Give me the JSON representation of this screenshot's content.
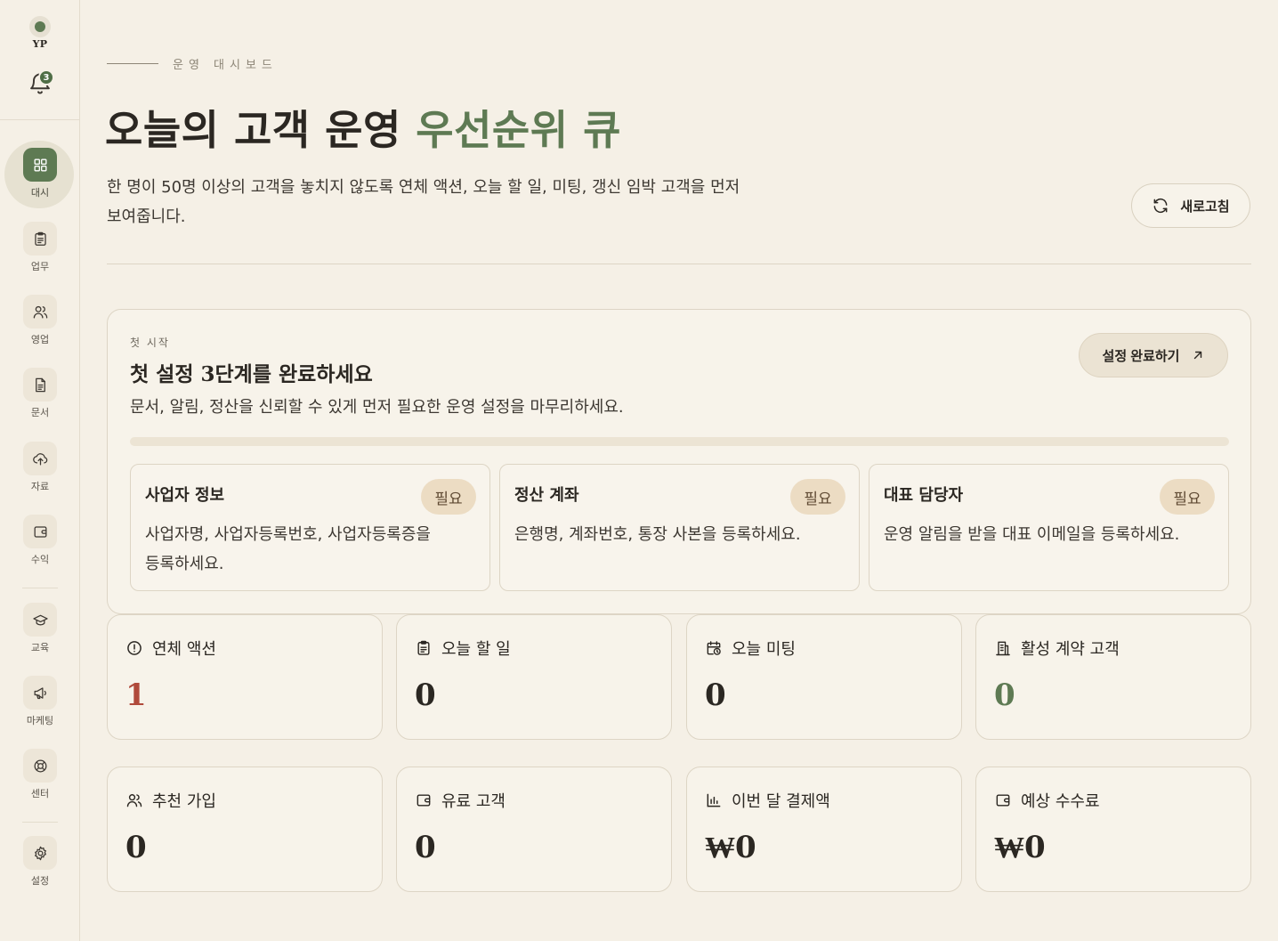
{
  "sidebar": {
    "profile_initials": "YP",
    "notifications_count": "3",
    "items": [
      {
        "label": "대시",
        "icon": "grid-icon",
        "active": true
      },
      {
        "label": "업무",
        "icon": "clipboard-icon"
      },
      {
        "label": "영업",
        "icon": "users-icon"
      },
      {
        "label": "문서",
        "icon": "document-icon"
      },
      {
        "label": "자료",
        "icon": "cloud-upload-icon"
      },
      {
        "label": "수익",
        "icon": "wallet-icon"
      },
      {
        "label": "교육",
        "icon": "graduation-cap-icon"
      },
      {
        "label": "마케팅",
        "icon": "megaphone-icon"
      },
      {
        "label": "센터",
        "icon": "lifebuoy-icon"
      },
      {
        "label": "설정",
        "icon": "gear-icon"
      }
    ]
  },
  "header": {
    "eyebrow": "운영 대시보드",
    "title_main": "오늘의 고객 운영 ",
    "title_accent": "우선순위 큐",
    "description": "한 명이 50명 이상의 고객을 놓치지 않도록 연체 액션, 오늘 할 일, 미팅, 갱신 임박 고객을 먼저 보여줍니다.",
    "refresh_label": "새로고침"
  },
  "setup": {
    "eyebrow": "첫 시작",
    "title": "첫 설정 3단계를 완료하세요",
    "description": "문서, 알림, 정산을 신뢰할 수 있게 먼저 필요한 운영 설정을 마무리하세요.",
    "button_label": "설정 완료하기",
    "progress_percent": 0,
    "steps": [
      {
        "title": "사업자 정보",
        "badge": "필요",
        "description": "사업자명, 사업자등록번호, 사업자등록증을 등록하세요."
      },
      {
        "title": "정산 계좌",
        "badge": "필요",
        "description": "은행명, 계좌번호, 통장 사본을 등록하세요."
      },
      {
        "title": "대표 담당자",
        "badge": "필요",
        "description": "운영 알림을 받을 대표 이메일을 등록하세요."
      }
    ]
  },
  "stats": [
    {
      "label": "연체 액션",
      "value": "1",
      "icon": "alert-circle-icon",
      "tone": "red"
    },
    {
      "label": "오늘 할 일",
      "value": "0",
      "icon": "clipboard-icon",
      "tone": "default"
    },
    {
      "label": "오늘 미팅",
      "value": "0",
      "icon": "calendar-clock-icon",
      "tone": "default"
    },
    {
      "label": "활성 계약 고객",
      "value": "0",
      "icon": "building-icon",
      "tone": "green"
    },
    {
      "label": "추천 가입",
      "value": "0",
      "icon": "users-icon",
      "tone": "default"
    },
    {
      "label": "유료 고객",
      "value": "0",
      "icon": "wallet-icon",
      "tone": "default"
    },
    {
      "label": "이번 달 결제액",
      "value": "₩0",
      "icon": "bar-chart-icon",
      "tone": "default"
    },
    {
      "label": "예상 수수료",
      "value": "₩0",
      "icon": "wallet-icon",
      "tone": "default"
    }
  ],
  "colors": {
    "background": "#f5f0e6",
    "accent": "#5e7a53",
    "danger": "#b04a3b",
    "badge": "#ecdcc3"
  }
}
